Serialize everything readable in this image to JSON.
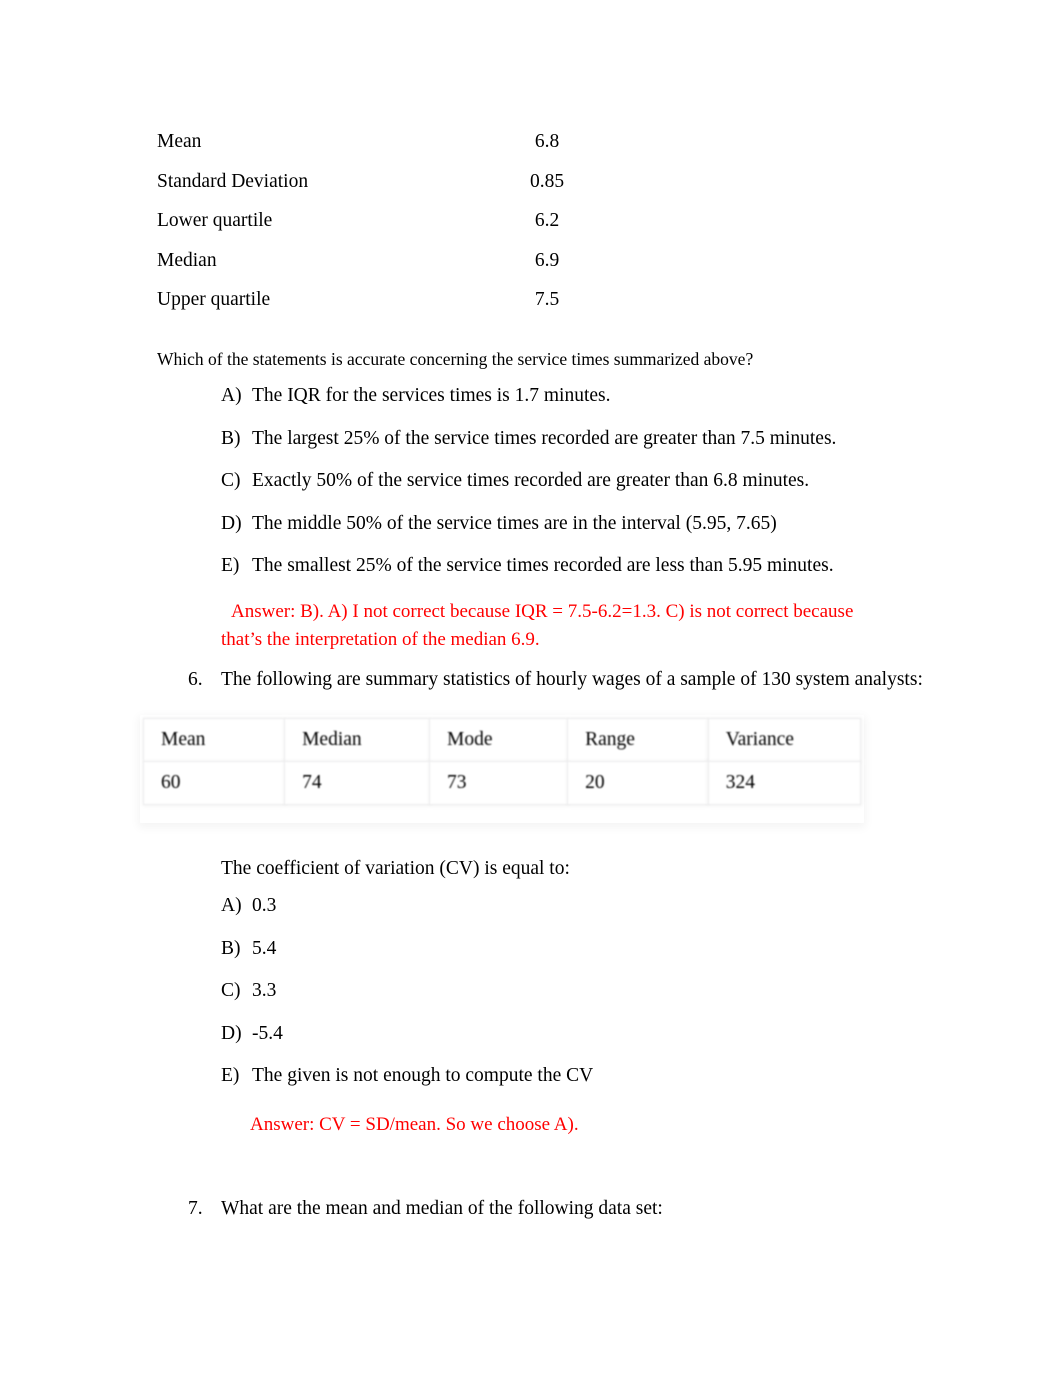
{
  "summary_stats": {
    "rows": [
      {
        "label": "Mean",
        "value": "6.8"
      },
      {
        "label": "Standard Deviation",
        "value": "0.85"
      },
      {
        "label": "Lower quartile",
        "value": "6.2"
      },
      {
        "label": "Median",
        "value": "6.9"
      },
      {
        "label": "Upper quartile",
        "value": "7.5"
      }
    ]
  },
  "question5": {
    "stem": "Which of the statements is accurate concerning the service times summarized above?",
    "options": [
      {
        "letter": "A)",
        "text": "The IQR for the services times is 1.7 minutes."
      },
      {
        "letter": "B)",
        "text": "The largest 25% of the service times recorded are greater than 7.5 minutes."
      },
      {
        "letter": "C)",
        "text": "Exactly 50% of the service times recorded are greater than 6.8 minutes."
      },
      {
        "letter": "D)",
        "text": "The middle 50% of the service times are in the interval (5.95, 7.65)"
      },
      {
        "letter": "E)",
        "text": "The smallest 25% of the service times recorded are less than 5.95 minutes."
      }
    ],
    "answer_line1": "Answer:  B).  A) I not correct because IQR = 7.5-6.2=1.3.  C) is not correct because",
    "answer_line2": "that’s the interpretation of the median 6.9."
  },
  "question6": {
    "number": "6.",
    "text": "The following are summary statistics of hourly wages of a sample of 130 system analysts:",
    "table": {
      "headers": [
        "Mean",
        "Median",
        "Mode",
        "Range",
        "Variance"
      ],
      "values": [
        "60",
        "74",
        "73",
        "20",
        "324"
      ]
    },
    "prompt": "The coefficient of variation (CV) is equal to:",
    "options": [
      {
        "letter": "A)",
        "text": "0.3"
      },
      {
        "letter": "B)",
        "text": "5.4"
      },
      {
        "letter": "C)",
        "text": "3.3"
      },
      {
        "letter": "D)",
        "text": "-5.4"
      },
      {
        "letter": "E)",
        "text": "The given is not enough to compute the CV"
      }
    ],
    "answer": "Answer: CV = SD/mean.  So we choose A)."
  },
  "question7": {
    "number": "7.",
    "text": "What are the mean and median of the following data set:"
  },
  "colors": {
    "answer_red": "#ff0000",
    "body_text": "#000000",
    "table_border": "#ececed",
    "page_background": "#ffffff"
  }
}
